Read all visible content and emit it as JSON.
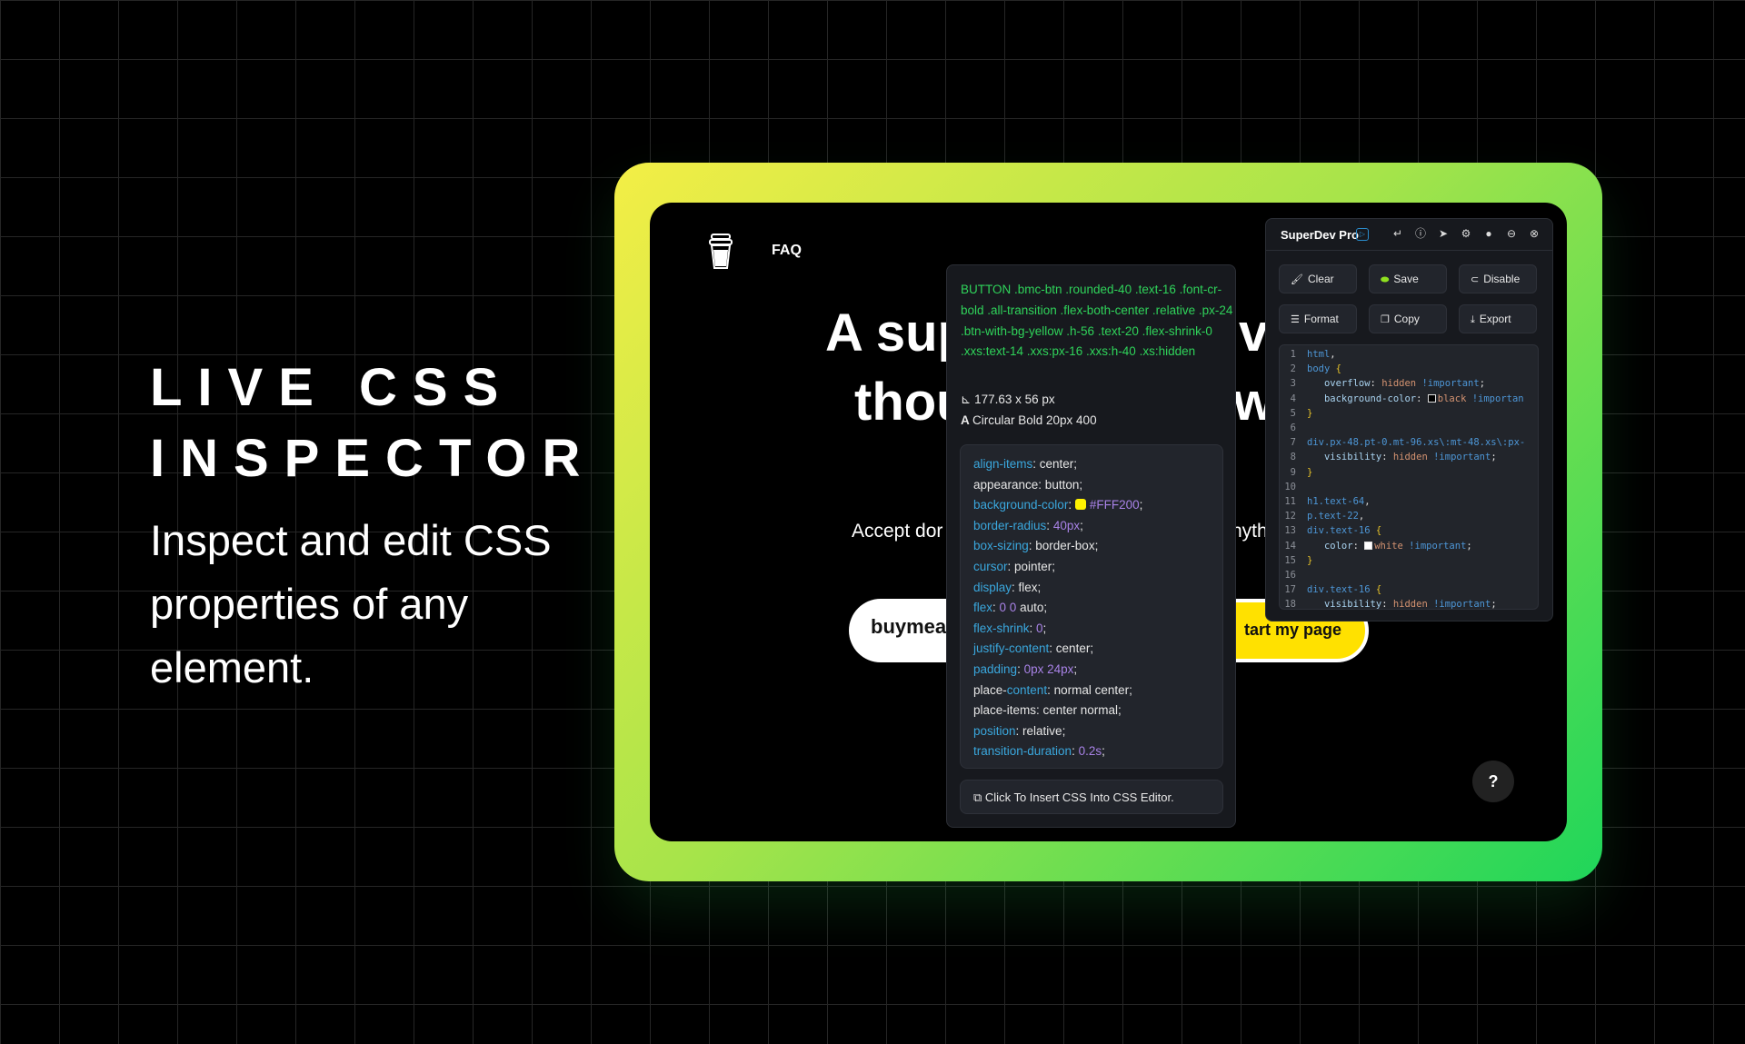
{
  "hero": {
    "title_line1": "LIVE CSS",
    "title_line2": "INSPECTOR",
    "subtitle": "Inspect and edit CSS properties of any element."
  },
  "site": {
    "nav_faq": "FAQ",
    "headline_l1a": "A sup",
    "headline_l1b": "vc",
    "headline_l2a": "thou",
    "headline_l2b": "w",
    "sub_a": "Accept dor",
    "sub_b": "nyth",
    "btn_white": "buymea",
    "btn_yellow": "tart my page",
    "help": "?"
  },
  "inspector": {
    "selector": "BUTTON .bmc-btn .rounded-40 .text-16 .font-cr-bold .all-transition .flex-both-center .relative .px-24 .btn-with-bg-yellow .h-56 .text-20 .flex-shrink-0 .xxs:text-14 .xxs:px-16 .xxs:h-40 .xs:hidden",
    "dimensions": "177.63 x 56 px",
    "font": "Circular Bold 20px 400",
    "properties": [
      [
        [
          "k",
          "align-items"
        ],
        [
          "v",
          ": center;"
        ]
      ],
      [
        [
          "v",
          "appearance: button;"
        ]
      ],
      [
        [
          "k",
          "background-color"
        ],
        [
          "v",
          ": "
        ],
        [
          "sw",
          "#FFF200"
        ],
        [
          "n",
          "#FFF200"
        ],
        [
          "v",
          ";"
        ]
      ],
      [
        [
          "k",
          "border-radius"
        ],
        [
          "v",
          ": "
        ],
        [
          "n",
          "40px"
        ],
        [
          "v",
          ";"
        ]
      ],
      [
        [
          "k",
          "box-sizing"
        ],
        [
          "v",
          ": border-box;"
        ]
      ],
      [
        [
          "k",
          "cursor"
        ],
        [
          "v",
          ": pointer;"
        ]
      ],
      [
        [
          "k",
          "display"
        ],
        [
          "v",
          ": flex;"
        ]
      ],
      [
        [
          "k",
          "flex"
        ],
        [
          "v",
          ": "
        ],
        [
          "n",
          "0 0"
        ],
        [
          "v",
          " auto;"
        ]
      ],
      [
        [
          "k",
          "flex-shrink"
        ],
        [
          "v",
          ": "
        ],
        [
          "n",
          "0"
        ],
        [
          "v",
          ";"
        ]
      ],
      [
        [
          "k",
          "justify-content"
        ],
        [
          "v",
          ": center;"
        ]
      ],
      [
        [
          "k",
          "padding"
        ],
        [
          "v",
          ": "
        ],
        [
          "n",
          "0px 24px"
        ],
        [
          "v",
          ";"
        ]
      ],
      [
        [
          "v",
          "place-"
        ],
        [
          "k",
          "content"
        ],
        [
          "v",
          ": normal center;"
        ]
      ],
      [
        [
          "v",
          "place-items: center normal;"
        ]
      ],
      [
        [
          "k",
          "position"
        ],
        [
          "v",
          ": relative;"
        ]
      ],
      [
        [
          "k",
          "transition-duration"
        ],
        [
          "v",
          ": "
        ],
        [
          "n",
          "0.2s"
        ],
        [
          "v",
          ";"
        ]
      ]
    ],
    "insert_label": "Click To Insert CSS Into CSS Editor."
  },
  "superdev": {
    "title": "SuperDev Pro",
    "header_icons": [
      "enter-icon",
      "info-icon",
      "send-icon",
      "gear-icon",
      "fire-icon",
      "minimize-icon",
      "close-icon"
    ],
    "buttons": [
      {
        "label": "Clear",
        "icon": "brush-icon"
      },
      {
        "label": "Save",
        "icon": "toggle-on-icon"
      },
      {
        "label": "Disable",
        "icon": "toggle-off-icon"
      },
      {
        "label": "Format",
        "icon": "align-left-icon"
      },
      {
        "label": "Copy",
        "icon": "copy-icon"
      },
      {
        "label": "Export",
        "icon": "download-icon"
      }
    ],
    "code": [
      [
        [
          "sel",
          "html"
        ],
        [
          "punc",
          ","
        ]
      ],
      [
        [
          "sel",
          "body "
        ],
        [
          "brace",
          "{"
        ]
      ],
      [
        [
          "punc",
          "   "
        ],
        [
          "prop",
          "overflow"
        ],
        [
          "punc",
          ": "
        ],
        [
          "val",
          "hidden "
        ],
        [
          "imp",
          "!important"
        ],
        [
          "punc",
          ";"
        ]
      ],
      [
        [
          "punc",
          "   "
        ],
        [
          "prop",
          "background-color"
        ],
        [
          "punc",
          ": "
        ],
        [
          "swatch",
          "#000000"
        ],
        [
          "val",
          "black "
        ],
        [
          "imp",
          "!importan"
        ]
      ],
      [
        [
          "brace",
          "}"
        ]
      ],
      [],
      [
        [
          "sel",
          "div.px-48.pt-0.mt-96.xs\\:mt-48.xs\\:px-"
        ]
      ],
      [
        [
          "punc",
          "   "
        ],
        [
          "prop",
          "visibility"
        ],
        [
          "punc",
          ": "
        ],
        [
          "val",
          "hidden "
        ],
        [
          "imp",
          "!important"
        ],
        [
          "punc",
          ";"
        ]
      ],
      [
        [
          "brace",
          "}"
        ]
      ],
      [],
      [
        [
          "sel",
          "h1.text-64"
        ],
        [
          "punc",
          ","
        ]
      ],
      [
        [
          "sel",
          "p.text-22"
        ],
        [
          "punc",
          ","
        ]
      ],
      [
        [
          "sel",
          "div.text-16 "
        ],
        [
          "brace",
          "{"
        ]
      ],
      [
        [
          "punc",
          "   "
        ],
        [
          "prop",
          "color"
        ],
        [
          "punc",
          ": "
        ],
        [
          "swatch",
          "#ffffff"
        ],
        [
          "val",
          "white "
        ],
        [
          "imp",
          "!important"
        ],
        [
          "punc",
          ";"
        ]
      ],
      [
        [
          "brace",
          "}"
        ]
      ],
      [],
      [
        [
          "sel",
          "div.text-16 "
        ],
        [
          "brace",
          "{"
        ]
      ],
      [
        [
          "punc",
          "   "
        ],
        [
          "prop",
          "visibility"
        ],
        [
          "punc",
          ": "
        ],
        [
          "val",
          "hidden "
        ],
        [
          "imp",
          "!important"
        ],
        [
          "punc",
          ";"
        ]
      ]
    ]
  },
  "colors": {
    "frame_start": "#f4ee46",
    "frame_end": "#1fd65a",
    "accent_yellow": "#FFF200",
    "selector_green": "#2fd35a"
  }
}
